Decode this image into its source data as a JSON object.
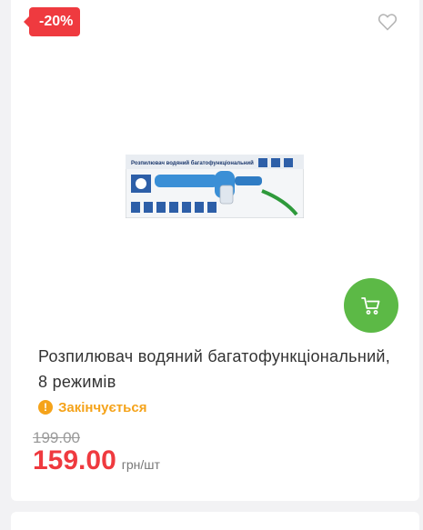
{
  "badge": {
    "discount": "-20%"
  },
  "icons": {
    "favorite": "heart-icon",
    "cart": "shopping-cart-icon",
    "status": "exclamation-icon"
  },
  "product": {
    "title": "Розпилювач водяний багатофункціональний, 8 режимів",
    "status": "Закінчується",
    "old_price": "199.00",
    "price": "159.00",
    "unit": "грн/шт",
    "box_text": "Розпилювач водяний багатофункціональний"
  },
  "colors": {
    "discount_red": "#ef3a3f",
    "cart_green": "#5cb946",
    "status_orange": "#f5a31a"
  }
}
